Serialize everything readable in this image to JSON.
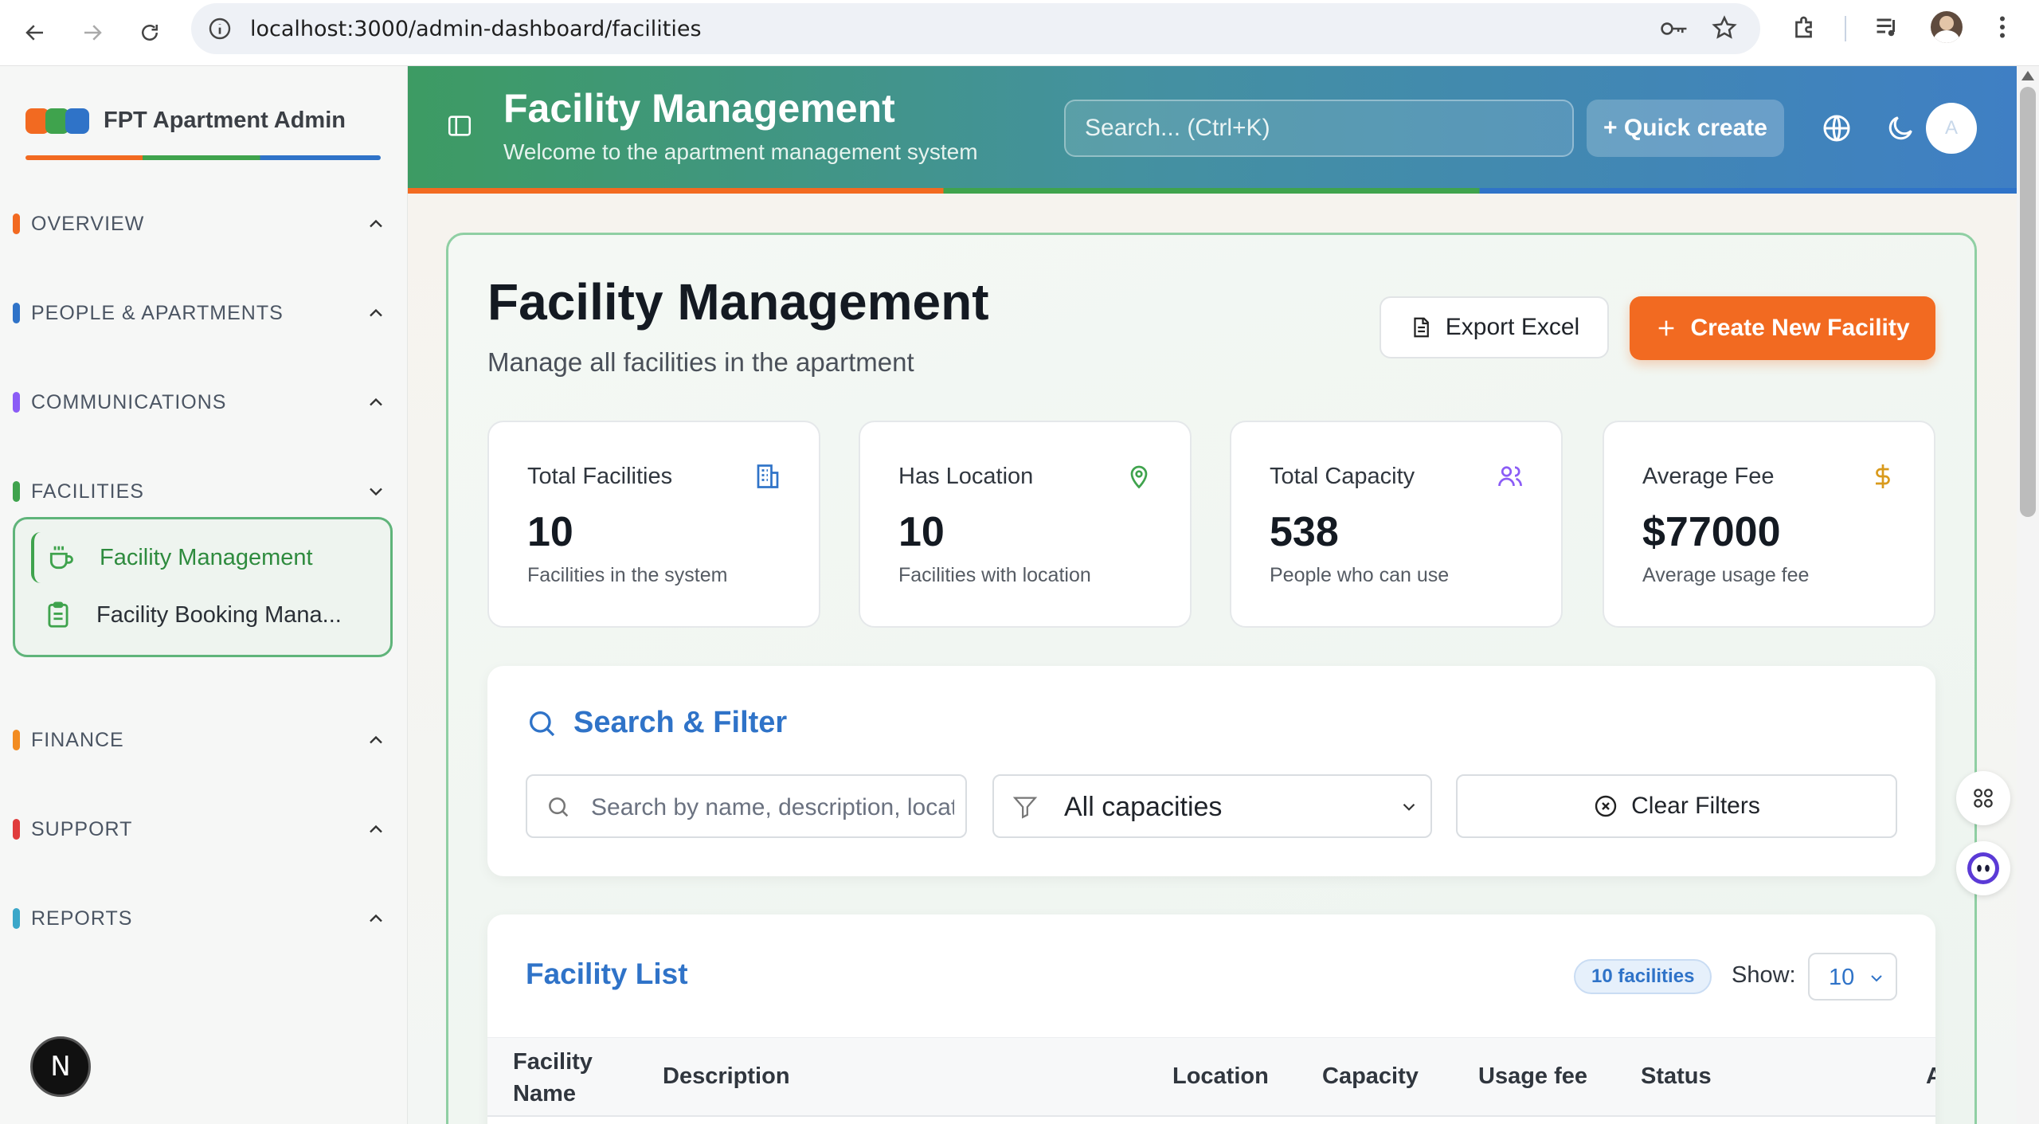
{
  "browser": {
    "url": "localhost:3000/admin-dashboard/facilities"
  },
  "sidebar": {
    "brand": "FPT Apartment Admin",
    "sections": [
      {
        "label": "OVERVIEW",
        "color": "#f26a21"
      },
      {
        "label": "PEOPLE & APARTMENTS",
        "color": "#2f73c8"
      },
      {
        "label": "COMMUNICATIONS",
        "color": "#8b5cf6"
      },
      {
        "label": "FACILITIES",
        "color": "#3fa34d"
      },
      {
        "label": "FINANCE",
        "color": "#f28c21"
      },
      {
        "label": "SUPPORT",
        "color": "#e03c3c"
      },
      {
        "label": "REPORTS",
        "color": "#3ba7c9"
      }
    ],
    "facility_items": [
      {
        "label": "Facility Management",
        "icon": "coffee-cup-icon",
        "active": true
      },
      {
        "label": "Facility Booking Mana...",
        "icon": "clipboard-icon",
        "active": false
      }
    ],
    "next_badge": "N"
  },
  "header": {
    "title": "Facility Management",
    "subtitle": "Welcome to the apartment management system",
    "search_placeholder": "Search... (Ctrl+K)",
    "quick_create": "+ Quick create",
    "avatar_initial": "A"
  },
  "page": {
    "title": "Facility Management",
    "subtitle": "Manage all facilities in the apartment",
    "export_label": "Export Excel",
    "create_label": "Create New Facility"
  },
  "stats": [
    {
      "label": "Total Facilities",
      "value": "10",
      "desc": "Facilities in the system",
      "icon": "building-icon",
      "color": "#2f73c8"
    },
    {
      "label": "Has Location",
      "value": "10",
      "desc": "Facilities with location",
      "icon": "map-pin-icon",
      "color": "#3fa34d"
    },
    {
      "label": "Total Capacity",
      "value": "538",
      "desc": "People who can use",
      "icon": "users-icon",
      "color": "#8b5cf6"
    },
    {
      "label": "Average Fee",
      "value": "$77000",
      "desc": "Average usage fee",
      "icon": "dollar-icon",
      "color": "#d99a1c"
    }
  ],
  "filter": {
    "title": "Search & Filter",
    "search_placeholder": "Search by name, description, location...",
    "capacity_value": "All capacities",
    "clear_label": "Clear Filters"
  },
  "list": {
    "title": "Facility List",
    "badge": "10 facilities",
    "show_label": "Show:",
    "show_value": "10",
    "columns": [
      "Facility\nName",
      "Description",
      "Location",
      "Capacity",
      "Usage fee",
      "Status",
      "A"
    ]
  }
}
